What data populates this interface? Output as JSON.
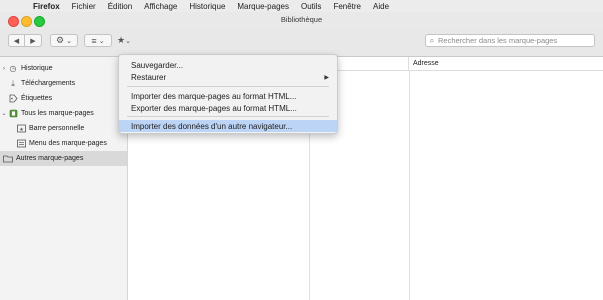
{
  "menubar": {
    "apple": "",
    "items": [
      "Firefox",
      "Fichier",
      "Édition",
      "Affichage",
      "Historique",
      "Marque-pages",
      "Outils",
      "Fenêtre",
      "Aide"
    ]
  },
  "window": {
    "title": "Bibliothèque",
    "traffic_lights": [
      "#fe5f57",
      "#febc2e",
      "#28c840"
    ]
  },
  "toolbar": {
    "back_glyph": "◀",
    "forward_glyph": "▶",
    "organize_glyph": "⚙",
    "views_glyph": "≡",
    "import_glyph": "★",
    "chevron": "⌄",
    "search_placeholder": "Rechercher dans les marque-pages"
  },
  "sidebar": {
    "items": [
      {
        "label": "Historique",
        "icon": "clock-icon",
        "twisty": "›"
      },
      {
        "label": "Téléchargements",
        "icon": "download-icon",
        "twisty": ""
      },
      {
        "label": "Étiquettes",
        "icon": "tag-icon",
        "twisty": ""
      },
      {
        "label": "Tous les marque-pages",
        "icon": "bookmarks-icon",
        "twisty": "⌄"
      },
      {
        "label": "Barre personnelle",
        "icon": "star-icon",
        "twisty": ""
      },
      {
        "label": "Menu des marque-pages",
        "icon": "menu-icon",
        "twisty": ""
      },
      {
        "label": "Autres marque-pages",
        "icon": "folder-icon",
        "twisty": ""
      }
    ]
  },
  "columns": {
    "name_fragment": "es",
    "address": "Adresse"
  },
  "import_menu": {
    "items": [
      {
        "label": "Sauvegarder..."
      },
      {
        "label": "Restaurer",
        "arrow": "▶"
      },
      {
        "label": "Importer des marque-pages au format HTML..."
      },
      {
        "label": "Exporter des marque-pages au format HTML..."
      },
      {
        "label": "Importer des données d'un autre navigateur..."
      }
    ]
  },
  "colors": {
    "menu_highlight": "#bcd4f6",
    "sidebar_selection": "#d9d9d9"
  }
}
